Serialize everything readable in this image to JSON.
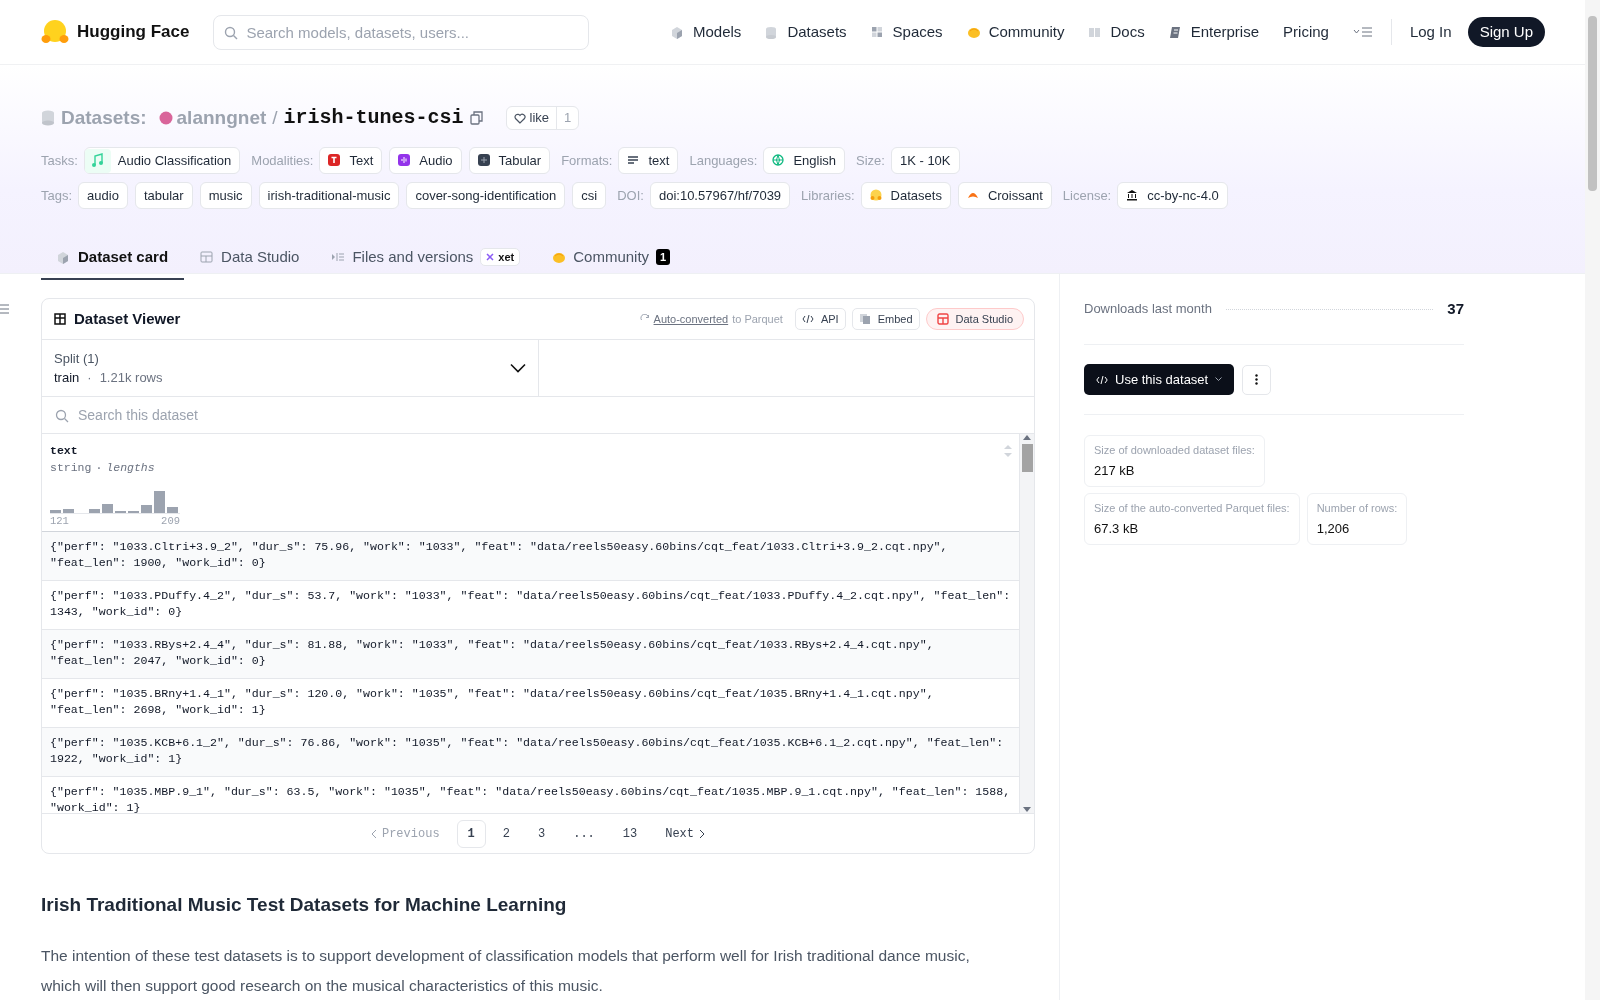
{
  "header": {
    "brand": "Hugging Face",
    "search": {
      "placeholder": "Search models, datasets, users..."
    },
    "nav": [
      {
        "label": "Models",
        "kind": "models"
      },
      {
        "label": "Datasets",
        "kind": "datasets"
      },
      {
        "label": "Spaces",
        "kind": "spaces"
      },
      {
        "label": "Community",
        "kind": "community"
      },
      {
        "label": "Docs",
        "kind": "docs"
      },
      {
        "label": "Enterprise",
        "kind": "enterprise"
      },
      {
        "label": "Pricing",
        "kind": "plain"
      }
    ],
    "login": "Log In",
    "signup": "Sign Up"
  },
  "repo": {
    "type_label": "Datasets:",
    "owner": "alanngnet",
    "separator": "/",
    "name": "irish-tunes-csi",
    "like_label": "like",
    "like_count": "1"
  },
  "meta_rows": [
    [
      {
        "label": "Tasks:",
        "chips": [
          {
            "text": "Audio Classification",
            "kind": "audio-task"
          }
        ]
      },
      {
        "label": "Modalities:",
        "chips": [
          {
            "text": "Text",
            "kind": "text-modality"
          },
          {
            "text": "Audio",
            "kind": "audio-modality"
          },
          {
            "text": "Tabular",
            "kind": "tabular-modality"
          }
        ]
      },
      {
        "label": "Formats:",
        "chips": [
          {
            "text": "text",
            "kind": "format"
          }
        ]
      },
      {
        "label": "Languages:",
        "chips": [
          {
            "text": "English",
            "kind": "language"
          }
        ]
      },
      {
        "label": "Size:",
        "chips": [
          {
            "text": "1K - 10K",
            "kind": "plain"
          }
        ]
      }
    ],
    [
      {
        "label": "Tags:",
        "chips": [
          {
            "text": "audio",
            "kind": "plain"
          },
          {
            "text": "tabular",
            "kind": "plain"
          },
          {
            "text": "music",
            "kind": "plain"
          },
          {
            "text": "irish-traditional-music",
            "kind": "plain"
          },
          {
            "text": "cover-song-identification",
            "kind": "plain"
          },
          {
            "text": "csi",
            "kind": "plain"
          }
        ]
      },
      {
        "label": "DOI:",
        "chips": [
          {
            "text": "doi:10.57967/hf/7039",
            "kind": "doi"
          }
        ]
      },
      {
        "label": "Libraries:",
        "chips": [
          {
            "text": "Datasets",
            "kind": "library-datasets"
          },
          {
            "text": "Croissant",
            "kind": "library-croissant"
          }
        ]
      },
      {
        "label": "License:",
        "chips": [
          {
            "text": "cc-by-nc-4.0",
            "kind": "license"
          }
        ]
      }
    ]
  ],
  "tabs": [
    {
      "label": "Dataset card",
      "kind": "card",
      "selected": true
    },
    {
      "label": "Data Studio",
      "kind": "studio",
      "selected": false
    },
    {
      "label": "Files and versions",
      "kind": "files",
      "badge": "xet",
      "selected": false
    },
    {
      "label": "Community",
      "kind": "community",
      "count": "1",
      "selected": false
    }
  ],
  "viewer": {
    "title": "Dataset Viewer",
    "converted_link": "Auto-converted",
    "converted_text": "to Parquet",
    "buttons": [
      {
        "label": "API",
        "kind": "api"
      },
      {
        "label": "Embed",
        "kind": "embed"
      },
      {
        "label": "Data Studio",
        "kind": "studio"
      }
    ],
    "split": {
      "label": "Split (1)",
      "name": "train",
      "separator": "·",
      "rows": "1.21k rows"
    },
    "search": {
      "placeholder": "Search this dataset"
    },
    "column": {
      "name": "text",
      "type": "string",
      "separator": "·",
      "stat": "lengths",
      "min_label": "121",
      "max_label": "209"
    },
    "rows": [
      "{\"perf\": \"1033.Cltri+3.9_2\", \"dur_s\": 75.96, \"work\": \"1033\", \"feat\": \"data/reels50easy.60bins/cqt_feat/1033.Cltri+3.9_2.cqt.npy\", \"feat_len\": 1900, \"work_id\": 0}",
      "{\"perf\": \"1033.PDuffy.4_2\", \"dur_s\": 53.7, \"work\": \"1033\", \"feat\": \"data/reels50easy.60bins/cqt_feat/1033.PDuffy.4_2.cqt.npy\", \"feat_len\": 1343, \"work_id\": 0}",
      "{\"perf\": \"1033.RBys+2.4_4\", \"dur_s\": 81.88, \"work\": \"1033\", \"feat\": \"data/reels50easy.60bins/cqt_feat/1033.RBys+2.4_4.cqt.npy\", \"feat_len\": 2047, \"work_id\": 0}",
      "{\"perf\": \"1035.BRny+1.4_1\", \"dur_s\": 120.0, \"work\": \"1035\", \"feat\": \"data/reels50easy.60bins/cqt_feat/1035.BRny+1.4_1.cqt.npy\", \"feat_len\": 2698, \"work_id\": 1}",
      "{\"perf\": \"1035.KCB+6.1_2\", \"dur_s\": 76.86, \"work\": \"1035\", \"feat\": \"data/reels50easy.60bins/cqt_feat/1035.KCB+6.1_2.cqt.npy\", \"feat_len\": 1922, \"work_id\": 1}",
      "{\"perf\": \"1035.MBP.9_1\", \"dur_s\": 63.5, \"work\": \"1035\", \"feat\": \"data/reels50easy.60bins/cqt_feat/1035.MBP.9_1.cqt.npy\", \"feat_len\": 1588, \"work_id\": 1}"
    ],
    "pagination": {
      "previous": {
        "label": "Previous",
        "disabled": true
      },
      "pages": [
        {
          "label": "1",
          "selected": true
        },
        {
          "label": "2",
          "selected": false
        },
        {
          "label": "3",
          "selected": false
        },
        {
          "label": "...",
          "selected": false
        },
        {
          "label": "13",
          "selected": false
        }
      ],
      "next": {
        "label": "Next",
        "disabled": false
      }
    }
  },
  "card": {
    "heading": "Irish Traditional Music Test Datasets for Machine Learning",
    "paragraph": "The intention of these test datasets is to support development of classification models that perform well for Irish traditional dance music, which will then support good research on the musical characteristics of this music."
  },
  "sidebar": {
    "downloads_label": "Downloads last month",
    "downloads_value": "37",
    "use_button": "Use this dataset",
    "stats_rows": [
      [
        {
          "label": "Size of downloaded dataset files:",
          "value": "217 kB"
        }
      ],
      [
        {
          "label": "Size of the auto-converted Parquet files:",
          "value": "67.3 kB"
        },
        {
          "label": "Number of rows:",
          "value": "1,206"
        }
      ]
    ]
  }
}
